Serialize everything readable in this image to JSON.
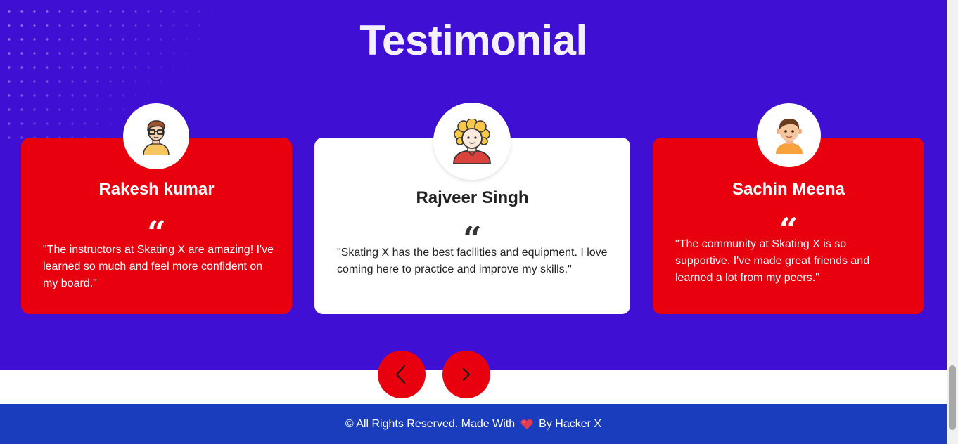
{
  "section": {
    "title": "Testimonial"
  },
  "testimonials": [
    {
      "name": "Rakesh kumar",
      "quote_mark": "“",
      "text": "\"The instructors at Skating X are amazing! I've learned so much and feel more confident on my board.\"",
      "avatar_icon": "man-with-glasses-avatar-icon",
      "style": "red"
    },
    {
      "name": "Rajveer Singh",
      "quote_mark": "“",
      "text": "\"Skating X has the best facilities and equipment. I love coming here to practice and improve my skills.\"",
      "avatar_icon": "curly-hair-man-avatar-icon",
      "style": "white"
    },
    {
      "name": "Sachin Meena",
      "quote_mark": "“",
      "text": "\"The community at Skating X is so supportive. I've made great friends and learned a lot from my peers.\"",
      "avatar_icon": "boy-avatar-icon",
      "style": "red"
    }
  ],
  "navigation": {
    "prev_icon": "chevron-left-icon",
    "next_icon": "chevron-right-icon"
  },
  "footer": {
    "text_before": "© All Rights Reserved. Made With",
    "heart_icon": "heart-icon",
    "text_after": "By Hacker X"
  },
  "colors": {
    "section_bg": "#3f0fd4",
    "card_red": "#e8000e",
    "card_white": "#ffffff",
    "nav_button": "#e8000e",
    "footer_bg": "#1a3dbd",
    "heart": "#e53950"
  }
}
